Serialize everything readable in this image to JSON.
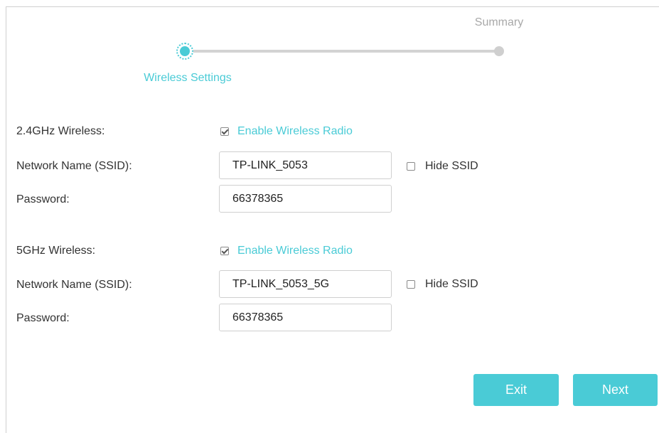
{
  "stepper": {
    "current_step": "Wireless Settings",
    "next_step": "Summary"
  },
  "band_24": {
    "section_label": "2.4GHz Wireless:",
    "enable_label": "Enable Wireless Radio",
    "enable_checked": true,
    "ssid_label": "Network Name (SSID):",
    "ssid_value": "TP-LINK_5053",
    "hide_ssid_label": "Hide SSID",
    "hide_ssid_checked": false,
    "password_label": "Password:",
    "password_value": "66378365"
  },
  "band_5": {
    "section_label": "5GHz Wireless:",
    "enable_label": "Enable Wireless Radio",
    "enable_checked": true,
    "ssid_label": "Network Name (SSID):",
    "ssid_value": "TP-LINK_5053_5G",
    "hide_ssid_label": "Hide SSID",
    "hide_ssid_checked": false,
    "password_label": "Password:",
    "password_value": "66378365"
  },
  "buttons": {
    "exit": "Exit",
    "next": "Next"
  },
  "colors": {
    "accent": "#4acbd6",
    "muted": "#a8a8a8",
    "text": "#333333"
  }
}
